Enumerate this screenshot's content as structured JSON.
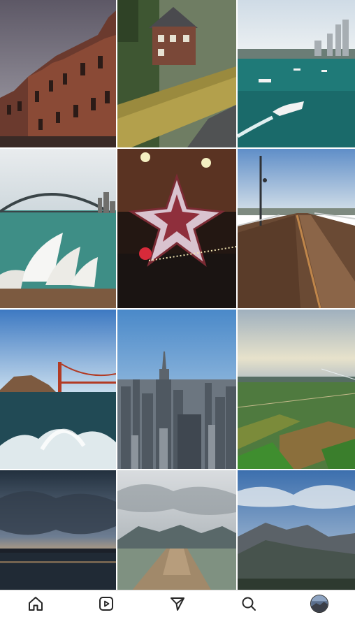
{
  "grid": {
    "posts": [
      {
        "subject": "brick-townhouses"
      },
      {
        "subject": "stone-cottage-hedge"
      },
      {
        "subject": "harbor-boats-skyline"
      },
      {
        "subject": "sydney-harbour-bridge-opera-house"
      },
      {
        "subject": "christmas-star-lantern"
      },
      {
        "subject": "wooden-pier-lamp"
      },
      {
        "subject": "golden-gate-bridge-waves"
      },
      {
        "subject": "empire-state-skyline"
      },
      {
        "subject": "aerial-farm-fields"
      },
      {
        "subject": "sunset-marina-clouds"
      },
      {
        "subject": "lake-jetty-mountains"
      },
      {
        "subject": "mountain-valley-clouds"
      }
    ]
  },
  "nav": {
    "items": [
      {
        "icon": "home-icon"
      },
      {
        "icon": "reels-icon"
      },
      {
        "icon": "send-icon"
      },
      {
        "icon": "search-icon"
      },
      {
        "icon": "profile-avatar"
      }
    ],
    "icon_color": "#262626"
  }
}
